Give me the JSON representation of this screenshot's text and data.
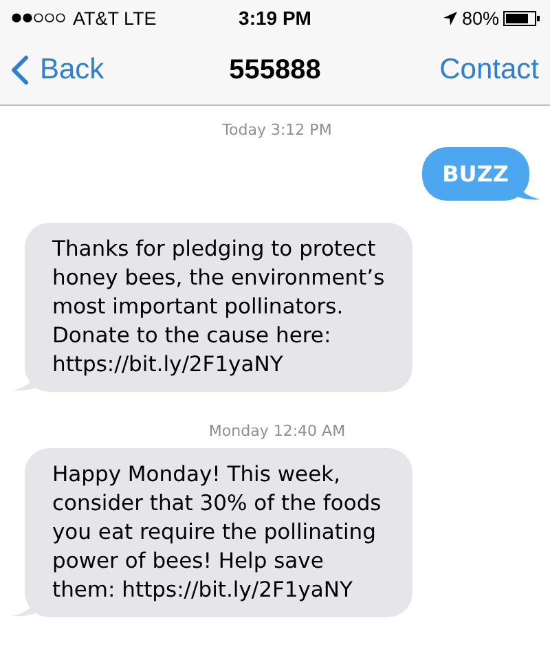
{
  "status_bar": {
    "carrier": "AT&T LTE",
    "time": "3:19 PM",
    "battery": "80%"
  },
  "nav_bar": {
    "back": "Back",
    "title": "555888",
    "action": "Contact"
  },
  "messages": [
    {
      "kind": "timestamp",
      "text": "Today 3:12 PM"
    },
    {
      "kind": "sent",
      "text": "BUZZ"
    },
    {
      "kind": "received",
      "text": "Thanks for pledging to protect\nhoney bees, the environment’s\nmost important pollinators.\nDonate to the cause here:\nhttps://bit.ly/2F1yaNY"
    },
    {
      "kind": "timestamp",
      "text": "Monday 12:40 AM"
    },
    {
      "kind": "received",
      "text": "Happy Monday! This week,\nconsider that 30% of the foods\nyou eat require the pollinating\npower of bees! Help save\nthem: https://bit.ly/2F1yaNY"
    }
  ]
}
